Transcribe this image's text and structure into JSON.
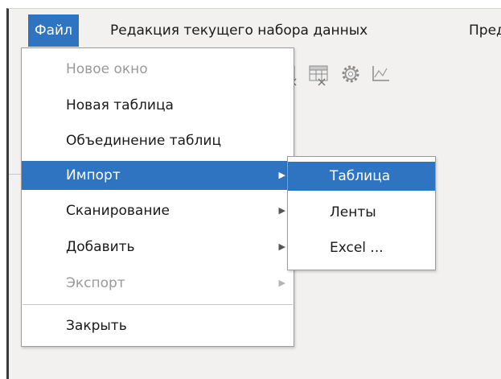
{
  "menubar": {
    "items": [
      {
        "label": "Файл",
        "active": true
      },
      {
        "label": "Редакция текущего набора данных",
        "active": false
      },
      {
        "label": "Пред",
        "active": false
      }
    ]
  },
  "toolbar": {
    "icons": [
      "table-delete-icon",
      "table-edit-icon",
      "gear-icon",
      "chart-icon"
    ]
  },
  "file_menu": {
    "items": [
      {
        "label": "Новое окно",
        "state": "disabled"
      },
      {
        "label": "Новая таблица",
        "state": "normal"
      },
      {
        "label": "Объединение таблиц",
        "state": "normal"
      },
      {
        "label": "Импорт",
        "state": "selected",
        "submenu": true
      },
      {
        "label": "Сканирование",
        "state": "normal",
        "submenu": true
      },
      {
        "label": "Добавить",
        "state": "normal",
        "submenu": true
      },
      {
        "label": "Экспорт",
        "state": "disabled",
        "submenu": true
      },
      {
        "label": "Закрыть",
        "state": "normal"
      }
    ]
  },
  "import_submenu": {
    "items": [
      {
        "label": "Таблица",
        "state": "selected"
      },
      {
        "label": "Ленты",
        "state": "normal"
      },
      {
        "label": "Excel ...",
        "state": "normal"
      }
    ]
  },
  "colors": {
    "accent": "#2f74c0",
    "disabled_text": "#9a9a9a",
    "menu_bg": "#ffffff",
    "window_bg": "#f2f1f0"
  }
}
